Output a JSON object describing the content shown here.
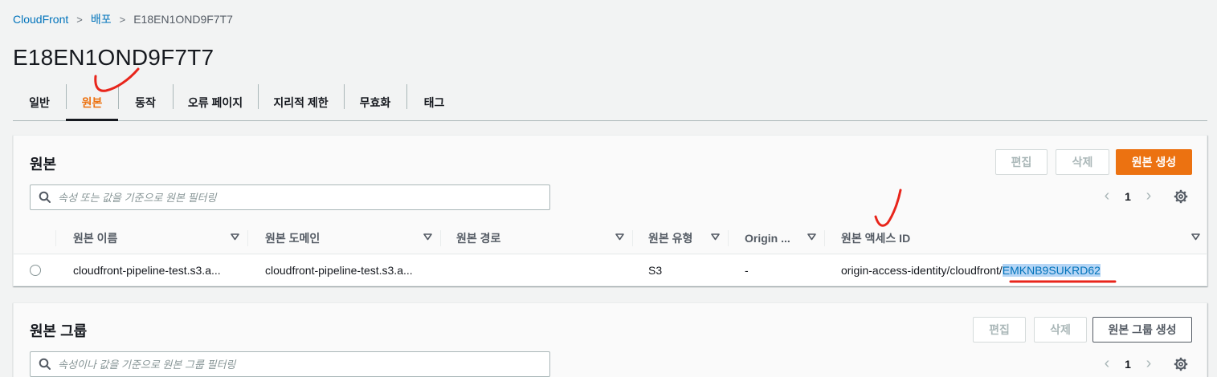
{
  "breadcrumb": {
    "root": "CloudFront",
    "section": "배포",
    "current": "E18EN1OND9F7T7"
  },
  "page": {
    "title": "E18EN1OND9F7T7"
  },
  "tabs": [
    {
      "label": "일반",
      "active": false
    },
    {
      "label": "원본",
      "active": true
    },
    {
      "label": "동작",
      "active": false
    },
    {
      "label": "오류 페이지",
      "active": false
    },
    {
      "label": "지리적 제한",
      "active": false
    },
    {
      "label": "무효화",
      "active": false
    },
    {
      "label": "태그",
      "active": false
    }
  ],
  "origins": {
    "title": "원본",
    "edit_label": "편집",
    "delete_label": "삭제",
    "create_label": "원본 생성",
    "filter_placeholder": "속성 또는 값을 기준으로 원본 필터링",
    "page_number": "1",
    "columns": [
      "원본 이름",
      "원본 도메인",
      "원본 경로",
      "원본 유형",
      "Origin ...",
      "원본 액세스 ID"
    ],
    "rows": [
      {
        "name": "cloudfront-pipeline-test.s3.a...",
        "domain": "cloudfront-pipeline-test.s3.a...",
        "path": "",
        "type": "S3",
        "origin_shield": "-",
        "access_id_prefix": "origin-access-identity/cloudfront/",
        "access_id_value": "EMKNB9SUKRD62"
      }
    ]
  },
  "origin_groups": {
    "title": "원본 그룹",
    "edit_label": "편집",
    "delete_label": "삭제",
    "create_label": "원본 그룹 생성",
    "filter_placeholder": "속성이나 값을 기준으로 원본 그룹 필터링",
    "page_number": "1"
  },
  "colors": {
    "accent": "#ec7211",
    "link": "#0073bb",
    "annotation": "#e8251b"
  },
  "icons": [
    "search-icon",
    "chevron-left-icon",
    "chevron-right-icon",
    "gear-icon",
    "sort-down-icon"
  ]
}
